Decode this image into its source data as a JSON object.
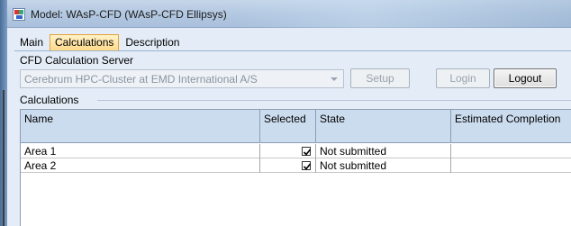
{
  "window": {
    "title": "Model: WAsP-CFD (WAsP-CFD Ellipsys)",
    "icon": "wasp-app-icon"
  },
  "tabs": [
    {
      "label": "Main",
      "active": false
    },
    {
      "label": "Calculations",
      "active": true
    },
    {
      "label": "Description",
      "active": false
    }
  ],
  "server": {
    "section_label": "CFD Calculation Server",
    "selected": "Cerebrum HPC-Cluster at EMD International A/S",
    "setup_label": "Setup",
    "login_label": "Login",
    "logout_label": "Logout"
  },
  "calculations": {
    "group_label": "Calculations",
    "columns": [
      "Name",
      "Selected",
      "State",
      "Estimated Completion"
    ],
    "rows": [
      {
        "name": "Area 1",
        "selected": true,
        "state": "Not submitted",
        "estimated": ""
      },
      {
        "name": "Area 2",
        "selected": true,
        "state": "Not submitted",
        "estimated": ""
      }
    ]
  },
  "colors": {
    "active_tab": "#ffd98a",
    "header_bg": "#ccdcef",
    "window_bg": "#e3ecf7"
  }
}
